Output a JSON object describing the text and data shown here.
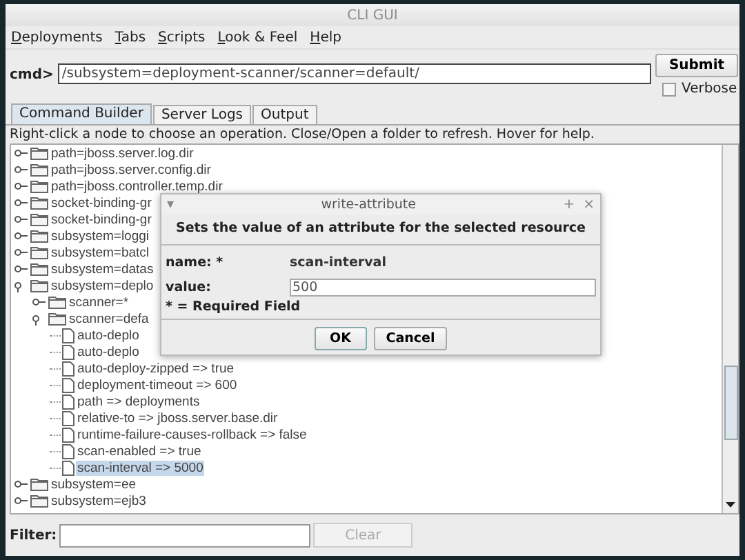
{
  "window": {
    "title": "CLI GUI"
  },
  "menu": [
    {
      "label": "Deployments"
    },
    {
      "label": "Tabs"
    },
    {
      "label": "Scripts"
    },
    {
      "label": "Look & Feel"
    },
    {
      "label": "Help"
    }
  ],
  "cmd": {
    "label": "cmd>",
    "value": "/subsystem=deployment-scanner/scanner=default/"
  },
  "submit": "Submit",
  "verbose": {
    "label": "Verbose",
    "checked": false
  },
  "tabs": [
    {
      "label": "Command Builder",
      "selected": true
    },
    {
      "label": "Server Logs",
      "selected": false
    },
    {
      "label": "Output",
      "selected": false
    }
  ],
  "hint": "Right-click a node to choose an operation.  Close/Open a folder to refresh.  Hover for help.",
  "tree": [
    {
      "kind": "folder",
      "label": "path=jboss.server.log.dir",
      "expanded": false,
      "selected": false
    },
    {
      "kind": "folder",
      "label": "path=jboss.server.config.dir",
      "expanded": false,
      "selected": false
    },
    {
      "kind": "folder",
      "label": "path=jboss.controller.temp.dir",
      "expanded": false,
      "selected": false
    },
    {
      "kind": "folder",
      "label": "socket-binding-gr",
      "expanded": false,
      "selected": false
    },
    {
      "kind": "folder",
      "label": "socket-binding-gr",
      "expanded": false,
      "selected": false
    },
    {
      "kind": "folder",
      "label": "subsystem=loggi",
      "expanded": false,
      "selected": false
    },
    {
      "kind": "folder",
      "label": "subsystem=batcl",
      "expanded": false,
      "selected": false
    },
    {
      "kind": "folder",
      "label": "subsystem=datas",
      "expanded": false,
      "selected": false
    },
    {
      "kind": "folder",
      "label": "subsystem=deplo",
      "expanded": true,
      "selected": false,
      "children": [
        {
          "kind": "folder",
          "label": "scanner=*",
          "expanded": false,
          "selected": false
        },
        {
          "kind": "folder",
          "label": "scanner=defa",
          "expanded": true,
          "selected": false,
          "children": [
            {
              "kind": "leaf",
              "label": "auto-deplo",
              "selected": false
            },
            {
              "kind": "leaf",
              "label": "auto-deplo",
              "selected": false
            },
            {
              "kind": "leaf",
              "label": "auto-deploy-zipped => true",
              "selected": false
            },
            {
              "kind": "leaf",
              "label": "deployment-timeout => 600",
              "selected": false
            },
            {
              "kind": "leaf",
              "label": "path => deployments",
              "selected": false
            },
            {
              "kind": "leaf",
              "label": "relative-to => jboss.server.base.dir",
              "selected": false
            },
            {
              "kind": "leaf",
              "label": "runtime-failure-causes-rollback => false",
              "selected": false
            },
            {
              "kind": "leaf",
              "label": "scan-enabled => true",
              "selected": false
            },
            {
              "kind": "leaf",
              "label": "scan-interval => 5000",
              "selected": true
            }
          ]
        }
      ]
    },
    {
      "kind": "folder",
      "label": "subsystem=ee",
      "expanded": false,
      "selected": false
    },
    {
      "kind": "folder",
      "label": "subsystem=ejb3",
      "expanded": false,
      "selected": false
    }
  ],
  "filter": {
    "label": "Filter:",
    "clear": "Clear",
    "clear_disabled": true
  },
  "dialog": {
    "title": "write-attribute",
    "menu_glyph": "▾",
    "max_glyph": "+",
    "close_glyph": "×",
    "heading": "Sets the value of an attribute for the selected resource",
    "name_label": "name: *",
    "name_value": "scan-interval",
    "value_label": "value:",
    "value": "500",
    "required_note": "* = Required Field",
    "buttons": [
      "OK",
      "Cancel"
    ]
  }
}
